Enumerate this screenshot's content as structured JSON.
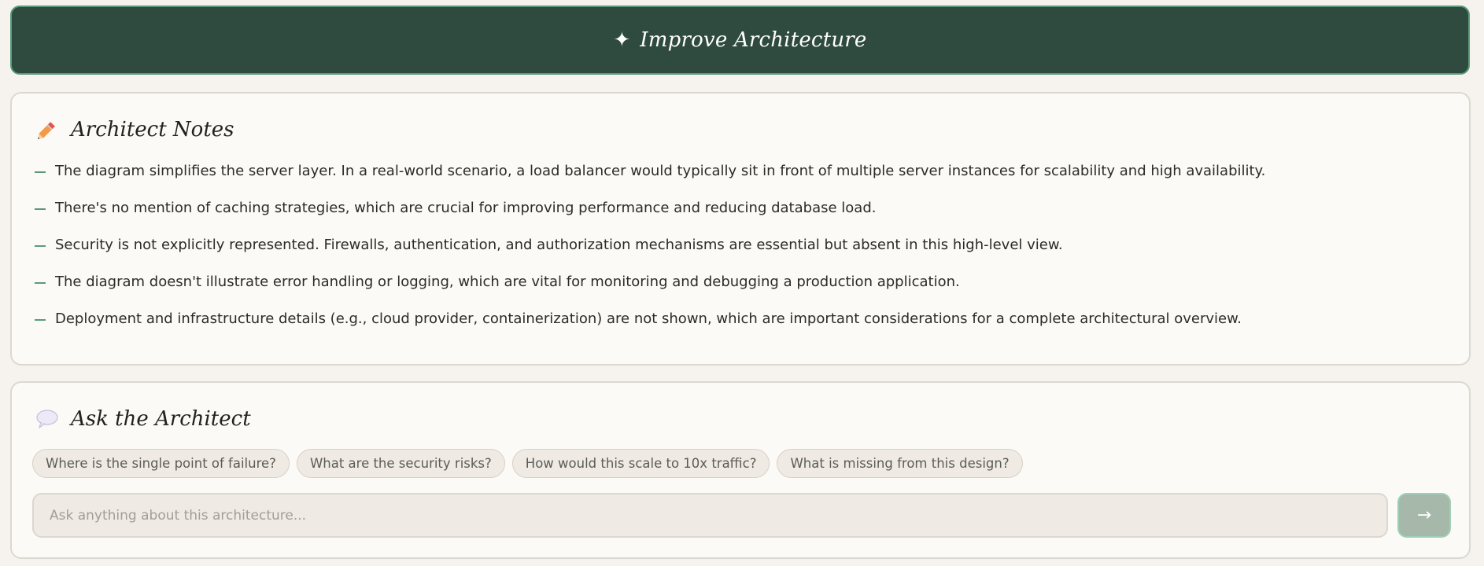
{
  "banner": {
    "icon": "sparkle-icon",
    "label": "Improve Architecture",
    "colors": {
      "background": "#2f4b40",
      "border": "#5a9a79"
    }
  },
  "notes": {
    "icon": "pencil-icon",
    "title": "Architect Notes",
    "items": [
      "The diagram simplifies the server layer. In a real-world scenario, a load balancer would typically sit in front of multiple server instances for scalability and high availability.",
      "There's no mention of caching strategies, which are crucial for improving performance and reducing database load.",
      "Security is not explicitly represented. Firewalls, authentication, and authorization mechanisms are essential but absent in this high-level view.",
      "The diagram doesn't illustrate error handling or logging, which are vital for monitoring and debugging a production application.",
      "Deployment and infrastructure details (e.g., cloud provider, containerization) are not shown, which are important considerations for a complete architectural overview."
    ]
  },
  "ask": {
    "icon": "speech-bubble-icon",
    "title": "Ask the Architect",
    "suggestions": [
      "Where is the single point of failure?",
      "What are the security risks?",
      "How would this scale to 10x traffic?",
      "What is missing from this design?"
    ],
    "input": {
      "value": "",
      "placeholder": "Ask anything about this architecture..."
    },
    "send": {
      "icon": "arrow-right-icon",
      "label": "→"
    }
  }
}
